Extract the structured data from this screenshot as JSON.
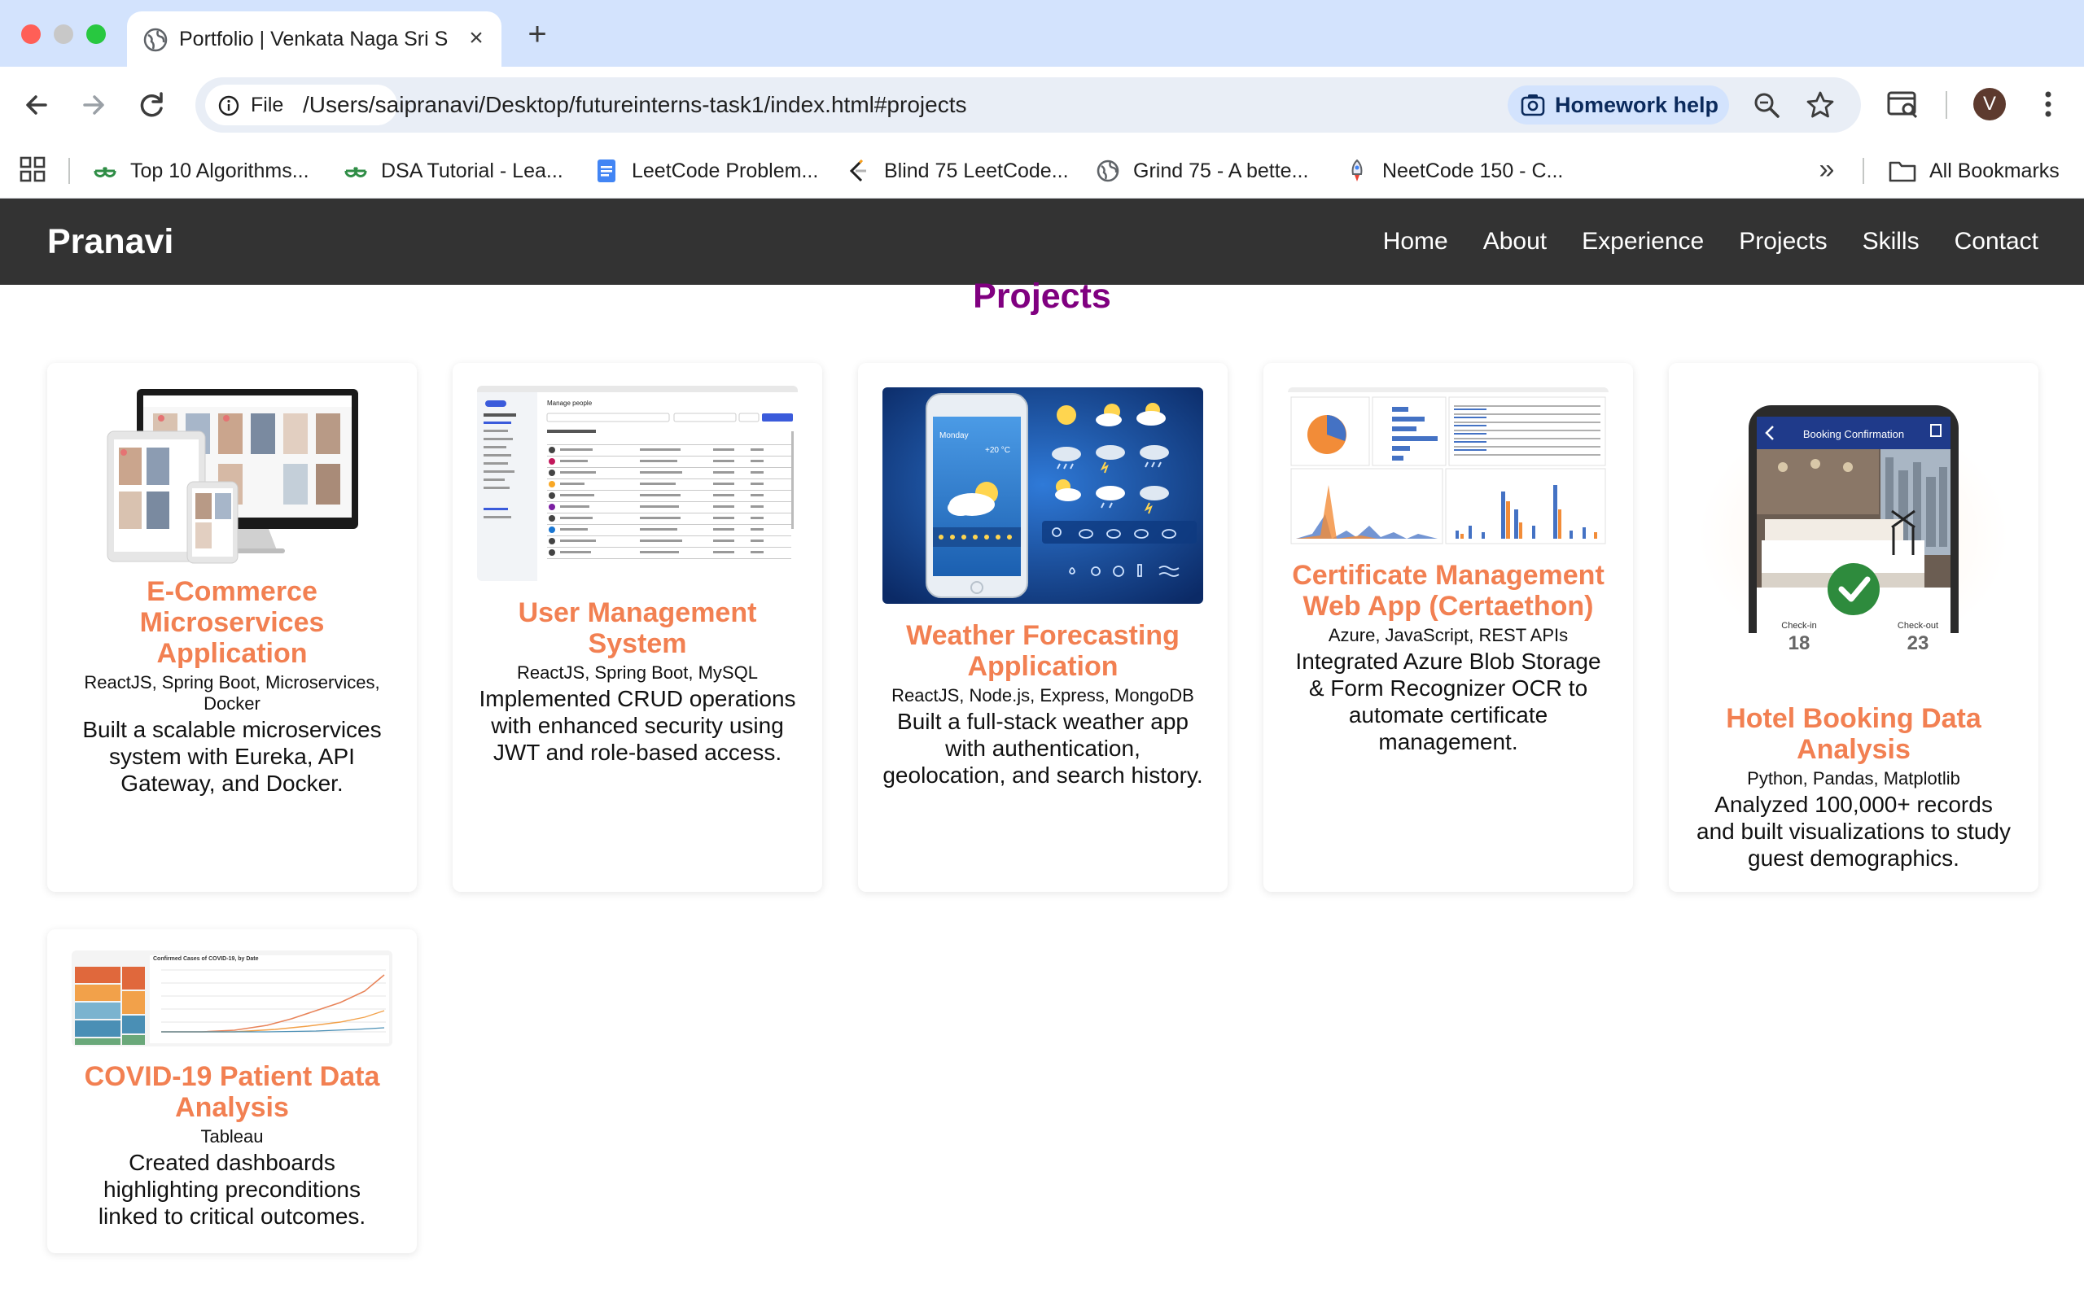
{
  "browser": {
    "tab_title": "Portfolio | Venkata Naga Sri Sai Pranavi",
    "site_chip_label": "File",
    "url": "/Users/saipranavi/Desktop/futureinterns-task1/index.html#projects",
    "homework_label": "Homework help",
    "avatar_initial": "V",
    "bookmarks": [
      {
        "label": "Top 10 Algorithms...",
        "icon": "geeksforgeeks-icon"
      },
      {
        "label": "DSA Tutorial - Lea...",
        "icon": "geeksforgeeks-icon"
      },
      {
        "label": "LeetCode Problem...",
        "icon": "google-docs-icon"
      },
      {
        "label": "Blind 75 LeetCode...",
        "icon": "leetcode-icon"
      },
      {
        "label": "Grind 75 - A bette...",
        "icon": "globe-icon"
      },
      {
        "label": "NeetCode 150 - C...",
        "icon": "rocket-icon"
      }
    ],
    "more_bookmarks": "»",
    "all_bookmarks_label": "All Bookmarks"
  },
  "site": {
    "brand": "Pranavi",
    "nav": [
      "Home",
      "About",
      "Experience",
      "Projects",
      "Skills",
      "Contact"
    ]
  },
  "section_title": "Projects",
  "projects": [
    {
      "title": "E-Commerce Microservices Application",
      "tech": "ReactJS, Spring Boot, Microservices, Docker",
      "desc": "Built a scalable microservices system with Eureka, API Gateway, and Docker.",
      "thumb": "ecommerce-devices-thumbnail"
    },
    {
      "title": "User Management System",
      "tech": "ReactJS, Spring Boot, MySQL",
      "desc": "Implemented CRUD operations with enhanced security using JWT and role-based access.",
      "thumb": "manage-people-thumbnail",
      "thumb_heading": "Manage people"
    },
    {
      "title": "Weather Forecasting Application",
      "tech": "ReactJS, Node.js, Express, MongoDB",
      "desc": "Built a full-stack weather app with authentication, geolocation, and search history.",
      "thumb": "weather-app-thumbnail",
      "thumb_day": "Monday",
      "thumb_temp": "+20 °C"
    },
    {
      "title": "Certificate Management Web App (Certaethon)",
      "tech": "Azure, JavaScript, REST APIs",
      "desc": "Integrated Azure Blob Storage & Form Recognizer OCR to automate certificate management.",
      "thumb": "dashboard-thumbnail"
    },
    {
      "title": "Hotel Booking Data Analysis",
      "tech": "Python, Pandas, Matplotlib",
      "desc": "Analyzed 100,000+ records and built visualizations to study guest demographics.",
      "thumb": "hotel-booking-thumbnail",
      "thumb_header": "Booking Confirmation",
      "thumb_checkin_label": "Check-in",
      "thumb_checkin": "18",
      "thumb_checkout_label": "Check-out",
      "thumb_checkout": "23"
    },
    {
      "title": "COVID-19 Patient Data Analysis",
      "tech": "Tableau",
      "desc": "Created dashboards highlighting preconditions linked to critical outcomes.",
      "thumb": "covid-dashboard-thumbnail",
      "thumb_heading": "Confirmed Cases of COVID-19, by Date"
    }
  ],
  "colors": {
    "nav_bg": "#333333",
    "section_title": "#800080",
    "card_title": "#f28052",
    "tab_strip": "#d3e3fd"
  }
}
